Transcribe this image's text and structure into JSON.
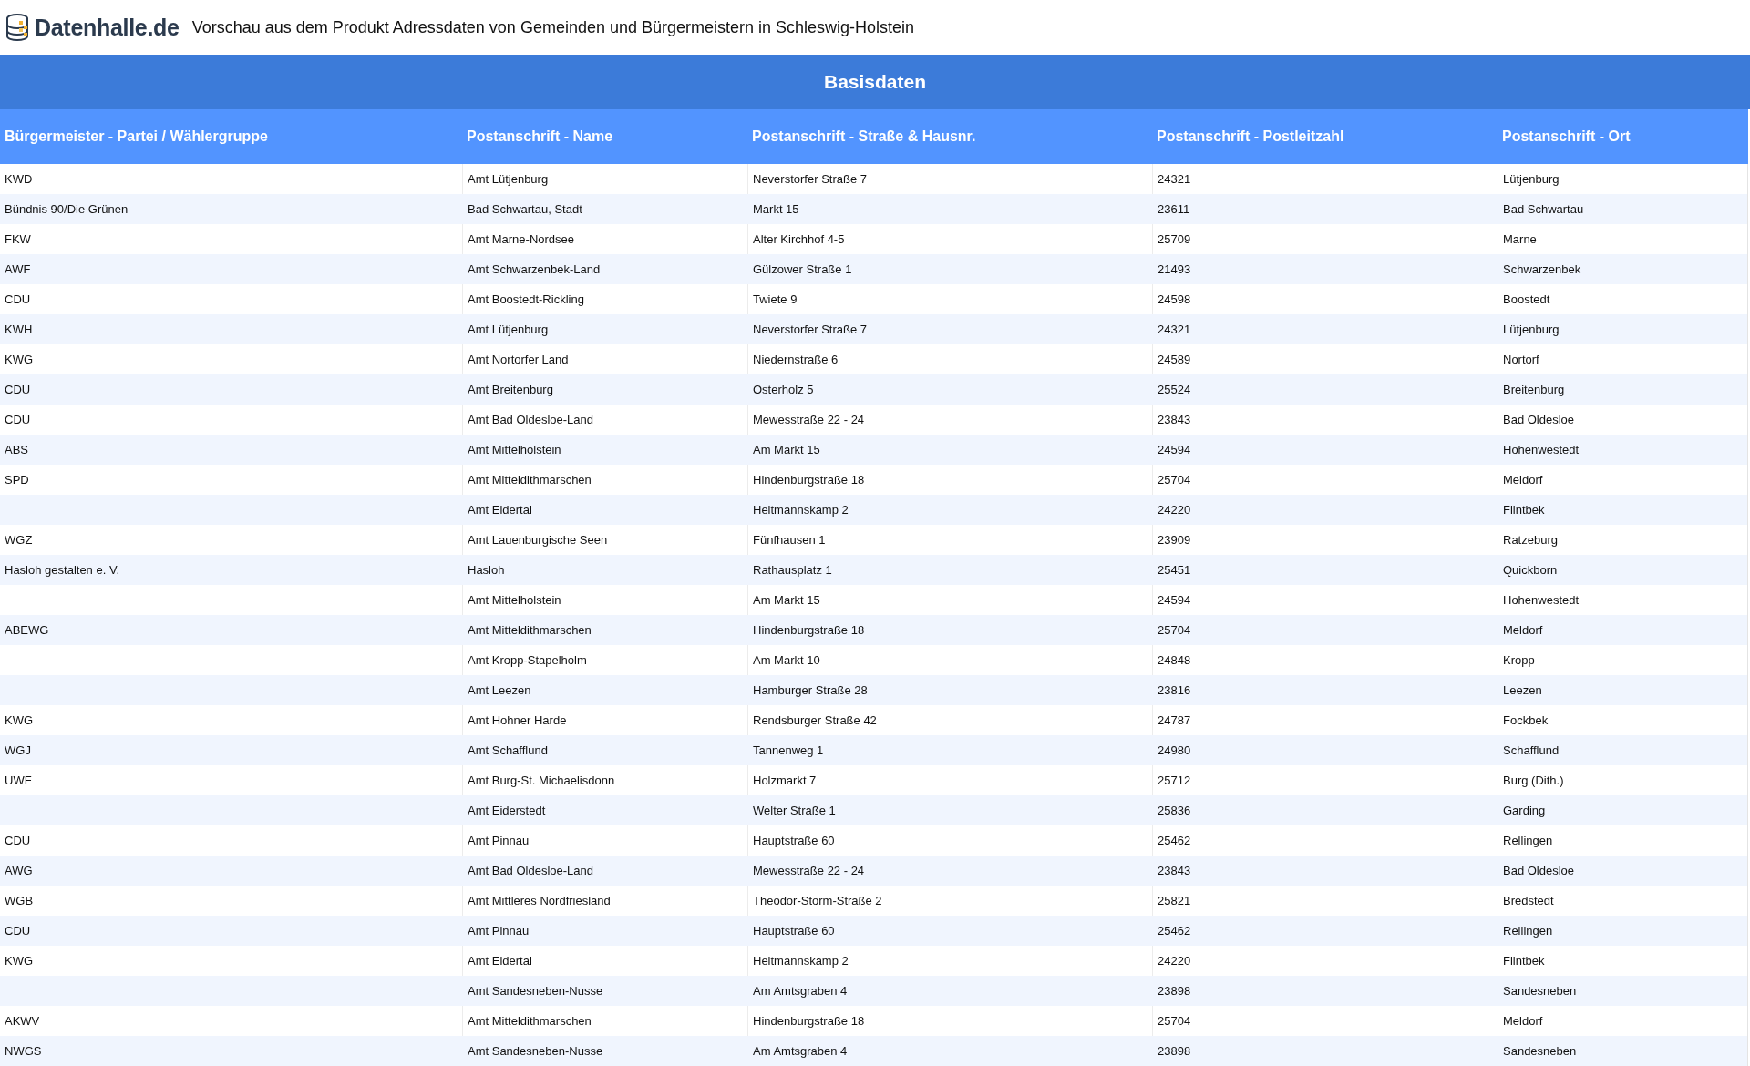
{
  "header": {
    "logo_text": "Datenhalle.de",
    "title": "Vorschau aus dem Produkt Adressdaten von Gemeinden und Bürgermeistern in Schleswig-Holstein"
  },
  "table": {
    "group_title": "Basisdaten",
    "columns": [
      "Bürgermeister - Partei / Wählergruppe",
      "Postanschrift - Name",
      "Postanschrift - Straße & Hausnr.",
      "Postanschrift - Postleitzahl",
      "Postanschrift - Ort"
    ],
    "rows": [
      [
        "KWD",
        "Amt Lütjenburg",
        "Neverstorfer Straße 7",
        "24321",
        "Lütjenburg"
      ],
      [
        "Bündnis 90/Die Grünen",
        "Bad Schwartau, Stadt",
        "Markt 15",
        "23611",
        "Bad Schwartau"
      ],
      [
        "FKW",
        "Amt Marne-Nordsee",
        "Alter Kirchhof 4-5",
        "25709",
        "Marne"
      ],
      [
        "AWF",
        "Amt Schwarzenbek-Land",
        "Gülzower Straße 1",
        "21493",
        "Schwarzenbek"
      ],
      [
        "CDU",
        "Amt Boostedt-Rickling",
        "Twiete 9",
        "24598",
        "Boostedt"
      ],
      [
        "KWH",
        "Amt Lütjenburg",
        "Neverstorfer Straße 7",
        "24321",
        "Lütjenburg"
      ],
      [
        "KWG",
        "Amt Nortorfer Land",
        "Niedernstraße 6",
        "24589",
        "Nortorf"
      ],
      [
        "CDU",
        "Amt Breitenburg",
        "Osterholz 5",
        "25524",
        "Breitenburg"
      ],
      [
        "CDU",
        "Amt Bad Oldesloe-Land",
        "Mewesstraße 22 - 24",
        "23843",
        "Bad Oldesloe"
      ],
      [
        "ABS",
        "Amt Mittelholstein",
        "Am Markt 15",
        "24594",
        "Hohenwestedt"
      ],
      [
        "SPD",
        "Amt Mitteldithmarschen",
        "Hindenburgstraße 18",
        "25704",
        "Meldorf"
      ],
      [
        "",
        "Amt Eidertal",
        "Heitmannskamp 2",
        "24220",
        "Flintbek"
      ],
      [
        "WGZ",
        "Amt Lauenburgische Seen",
        "Fünfhausen 1",
        "23909",
        "Ratzeburg"
      ],
      [
        "Hasloh gestalten e. V.",
        "Hasloh",
        "Rathausplatz 1",
        "25451",
        "Quickborn"
      ],
      [
        "",
        "Amt Mittelholstein",
        "Am Markt 15",
        "24594",
        "Hohenwestedt"
      ],
      [
        "ABEWG",
        "Amt Mitteldithmarschen",
        "Hindenburgstraße 18",
        "25704",
        "Meldorf"
      ],
      [
        "",
        "Amt Kropp-Stapelholm",
        "Am Markt 10",
        "24848",
        "Kropp"
      ],
      [
        "",
        "Amt Leezen",
        "Hamburger Straße 28",
        "23816",
        "Leezen"
      ],
      [
        "KWG",
        "Amt Hohner Harde",
        "Rendsburger Straße 42",
        "24787",
        "Fockbek"
      ],
      [
        "WGJ",
        "Amt Schafflund",
        "Tannenweg 1",
        "24980",
        "Schafflund"
      ],
      [
        "UWF",
        "Amt Burg-St. Michaelisdonn",
        "Holzmarkt 7",
        "25712",
        "Burg (Dith.)"
      ],
      [
        "",
        "Amt Eiderstedt",
        "Welter Straße 1",
        "25836",
        "Garding"
      ],
      [
        "CDU",
        "Amt Pinnau",
        "Hauptstraße 60",
        "25462",
        "Rellingen"
      ],
      [
        "AWG",
        "Amt Bad Oldesloe-Land",
        "Mewesstraße 22 - 24",
        "23843",
        "Bad Oldesloe"
      ],
      [
        "WGB",
        "Amt Mittleres Nordfriesland",
        "Theodor-Storm-Straße 2",
        "25821",
        "Bredstedt"
      ],
      [
        "CDU",
        "Amt Pinnau",
        "Hauptstraße 60",
        "25462",
        "Rellingen"
      ],
      [
        "KWG",
        "Amt Eidertal",
        "Heitmannskamp 2",
        "24220",
        "Flintbek"
      ],
      [
        "",
        "Amt Sandesneben-Nusse",
        "Am Amtsgraben 4",
        "23898",
        "Sandesneben"
      ],
      [
        "AKWV",
        "Amt Mitteldithmarschen",
        "Hindenburgstraße 18",
        "25704",
        "Meldorf"
      ],
      [
        "NWGS",
        "Amt Sandesneben-Nusse",
        "Am Amtsgraben 4",
        "23898",
        "Sandesneben"
      ]
    ]
  }
}
